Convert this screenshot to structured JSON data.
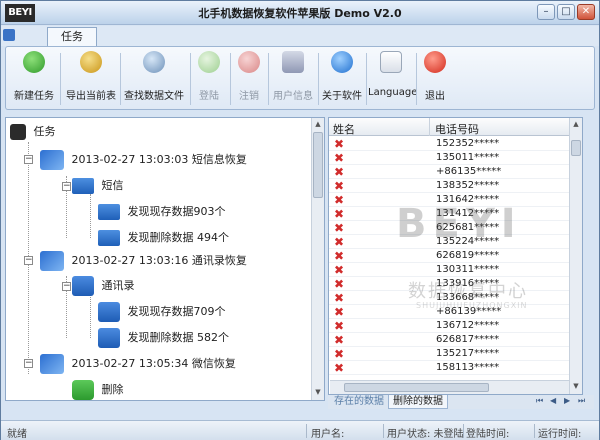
{
  "window": {
    "logo": "BEYI",
    "title": "手机数据恢复软件苹果版 Demo V2.0",
    "title_prefix": "北",
    "min_label": "–",
    "max_label": "□",
    "close_label": "✕"
  },
  "tabs": [
    {
      "label": "任务"
    }
  ],
  "toolbar": [
    {
      "label": "新建任务",
      "icon": "new-task-icon",
      "enabled": true
    },
    {
      "label": "导出当前表",
      "icon": "export-icon",
      "enabled": true
    },
    {
      "label": "查找数据文件",
      "icon": "search-icon",
      "enabled": true
    },
    {
      "label": "登陆",
      "icon": "login-icon",
      "enabled": false
    },
    {
      "label": "注销",
      "icon": "logout-icon",
      "enabled": false
    },
    {
      "label": "用户信息",
      "icon": "user-info-icon",
      "enabled": false
    },
    {
      "label": "关于软件",
      "icon": "info-icon",
      "enabled": true
    },
    {
      "label": "Language",
      "icon": "language-icon",
      "enabled": true
    },
    {
      "label": "退出",
      "icon": "exit-icon",
      "enabled": true
    }
  ],
  "tree": {
    "root": "任务",
    "tasks": [
      {
        "title": "2013-02-27 13:03:03 短信息恢复",
        "group": "短信",
        "children": [
          "发现现存数据903个",
          "发现删除数据 494个"
        ]
      },
      {
        "title": "2013-02-27 13:03:16 通讯录恢复",
        "group": "通讯录",
        "children": [
          "发现现存数据709个",
          "发现删除数据 582个"
        ]
      },
      {
        "title": "2013-02-27 13:05:34 微信恢复",
        "group": "删除",
        "children": []
      }
    ]
  },
  "grid": {
    "columns": [
      "姓名",
      "电话号码"
    ],
    "rows": [
      "152352*****",
      "135011*****",
      "+86135*****",
      "138352*****",
      "131642*****",
      "131412*****",
      "625681*****",
      "135224*****",
      "626819*****",
      "130311*****",
      "133916*****",
      "133668*****",
      "+86139*****",
      "136712*****",
      "626817*****",
      "135217*****",
      "158113*****"
    ]
  },
  "sheet_tabs": {
    "existing": "存在的数据",
    "deleted": "删除的数据",
    "nav": [
      "⏮",
      "◀",
      "▶",
      "⏭"
    ]
  },
  "watermark": {
    "big": "BEYI",
    "mid": "数据恢复中心",
    "small": "SHUJUHUIFUZHONGXIN"
  },
  "status": {
    "ready": "就绪",
    "username": "用户名:",
    "user_state": "用户状态: 未登陆",
    "login_time": "登陆时间:",
    "run_time": "运行时间:"
  },
  "colors": {
    "accent": "#3a73c6",
    "error": "#d12c2c",
    "frame": "#8fa9c9"
  }
}
